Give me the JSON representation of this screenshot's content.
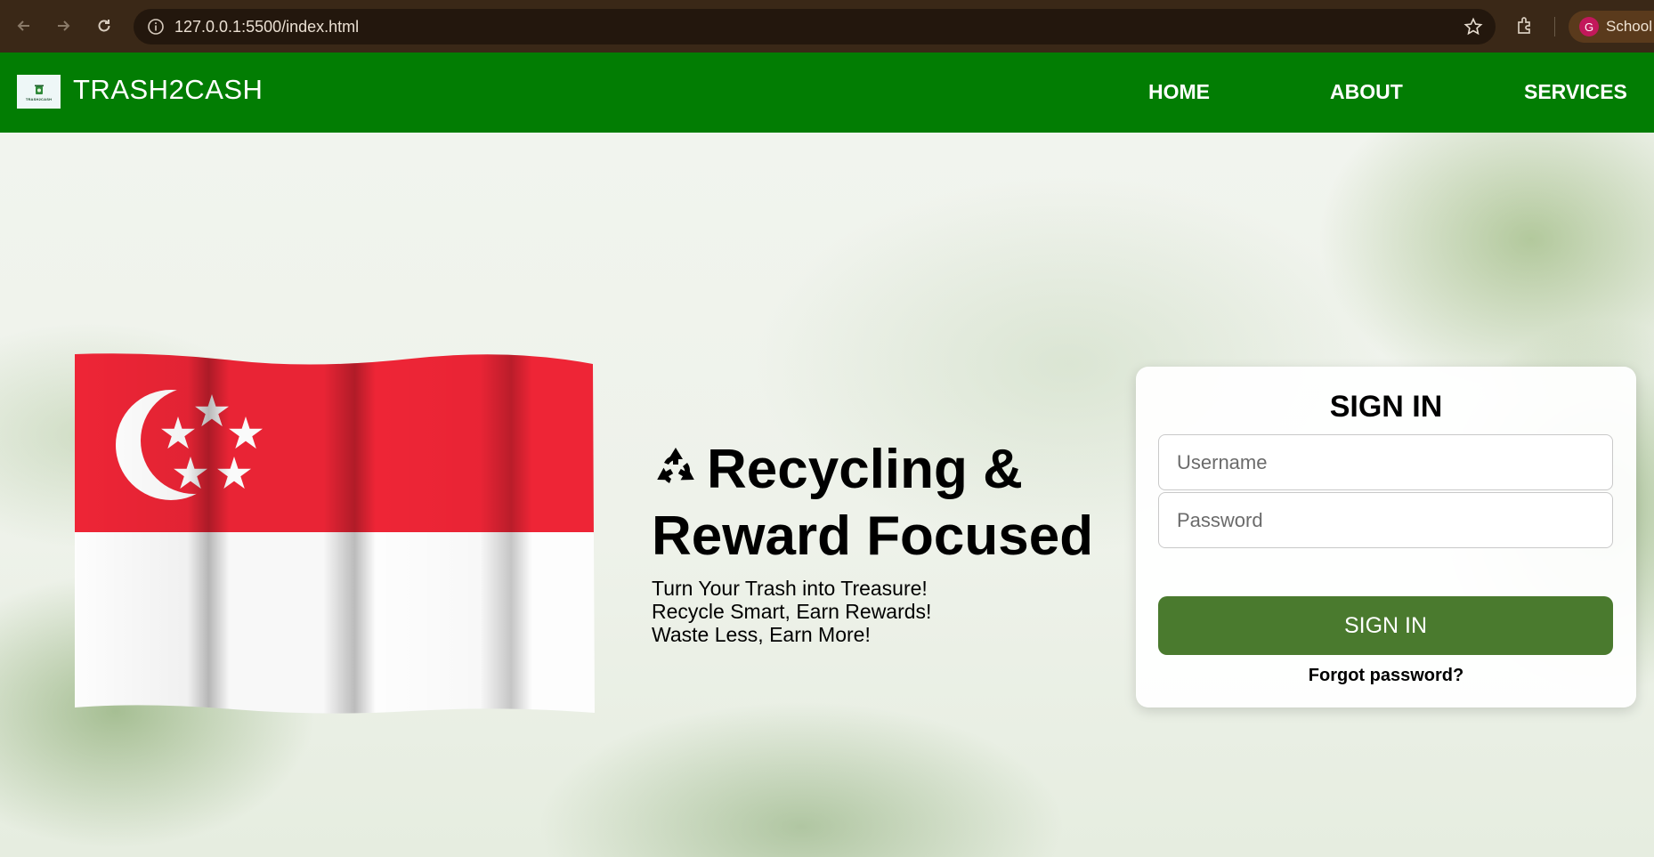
{
  "browser": {
    "url": "127.0.0.1:5500/index.html",
    "profile_initial": "G",
    "profile_name": "School"
  },
  "header": {
    "brand": "TRASH2CASH",
    "logo_text": "TRASH2CASH",
    "nav": [
      {
        "label": "HOME"
      },
      {
        "label": "ABOUT"
      },
      {
        "label": "SERVICES"
      }
    ]
  },
  "hero": {
    "headline_line1": "Recycling &",
    "headline_line2": "Reward Focused",
    "headline_icon": "recycle-icon",
    "taglines": [
      "Turn Your Trash into Treasure!",
      "Recycle Smart, Earn Rewards!",
      "Waste Less, Earn More!"
    ],
    "flag": "singapore-flag"
  },
  "signin": {
    "title": "SIGN IN",
    "username_placeholder": "Username",
    "password_placeholder": "Password",
    "button_label": "SIGN IN",
    "forgot_label": "Forgot password?"
  },
  "colors": {
    "header_green": "#027d03",
    "button_green": "#4a7a2e",
    "flag_red": "#ee2536",
    "browser_brown": "#3a2817"
  }
}
